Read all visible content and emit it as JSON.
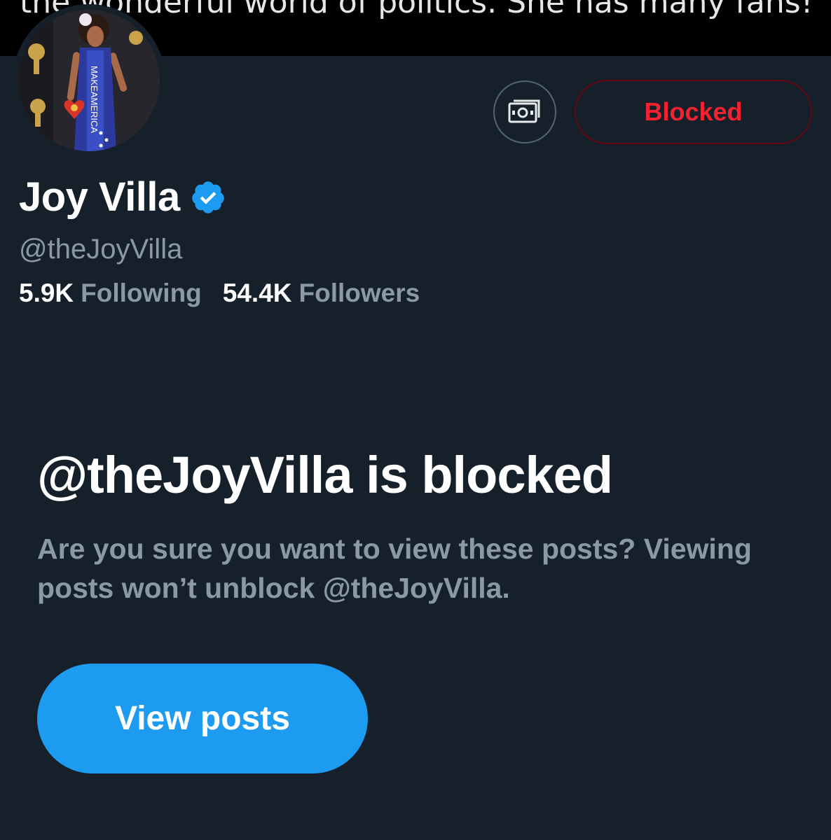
{
  "banner": {
    "caption": "the wonderful world of politics. She has many fans!"
  },
  "profile": {
    "display_name": "Joy Villa",
    "handle": "@theJoyVilla",
    "verified": true,
    "following_count": "5.9K",
    "following_label": "Following",
    "followers_count": "54.4K",
    "followers_label": "Followers",
    "avatar_icon": "profile-photo",
    "avatar_dress_text": "MAKEAMERICA"
  },
  "actions": {
    "tip_icon": "money-icon",
    "blocked_label": "Blocked"
  },
  "blocked_notice": {
    "title": "@theJoyVilla is blocked",
    "description": "Are you sure you want to view these posts? Viewing posts won’t unblock @theJoyVilla.",
    "button_label": "View posts"
  },
  "colors": {
    "background": "#16202b",
    "primary_text": "#ffffff",
    "secondary_text": "#8b98a5",
    "accent_blue": "#1d9bf0",
    "blocked_red": "#f4212e",
    "verified_blue": "#1d9bf0"
  }
}
